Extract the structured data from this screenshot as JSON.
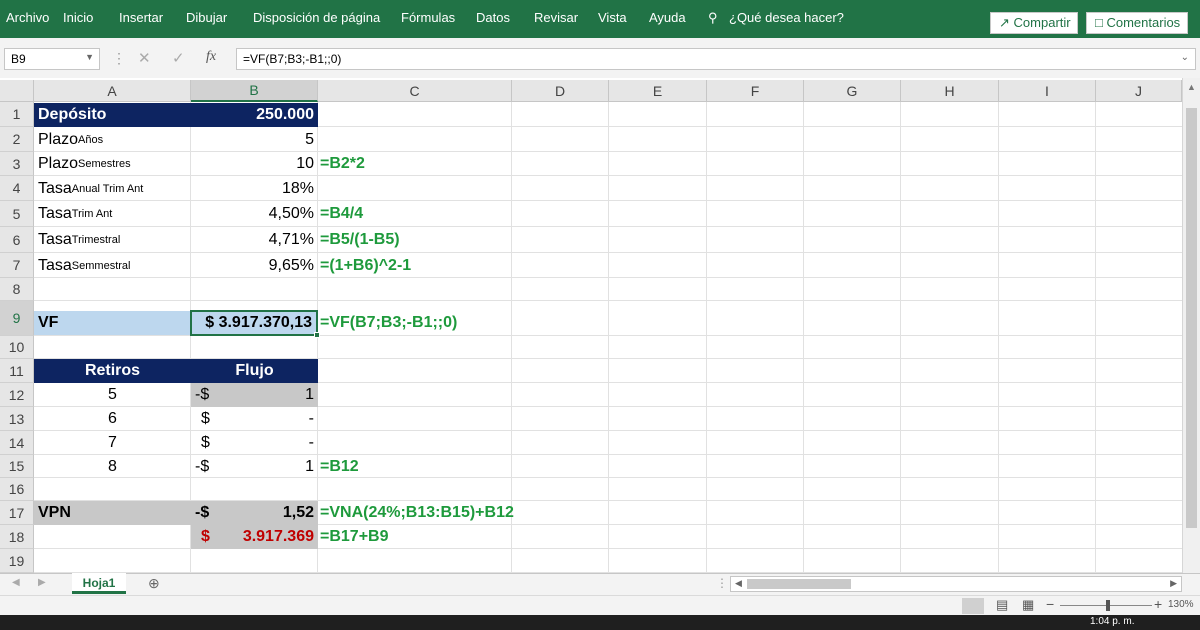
{
  "ribbon": {
    "menu": [
      "Archivo",
      "Inicio",
      "Insertar",
      "Dibujar",
      "Disposición de página",
      "Fórmulas",
      "Datos",
      "Revisar",
      "Vista",
      "Ayuda"
    ],
    "search_placeholder": "¿Qué desea hacer?",
    "share_label": "Compartir",
    "comments_label": "Comentarios"
  },
  "formula_bar": {
    "name_box": "B9",
    "formula": "=VF(B7;B3;-B1;;0)",
    "fx": "fx"
  },
  "columns": [
    "A",
    "B",
    "C",
    "D",
    "E",
    "F",
    "G",
    "H",
    "I",
    "J"
  ],
  "rows": [
    "1",
    "2",
    "3",
    "4",
    "5",
    "6",
    "7",
    "8",
    "9",
    "10",
    "11",
    "12",
    "13",
    "14",
    "15",
    "16",
    "17",
    "18",
    "19"
  ],
  "cells": {
    "a1": "Depósito",
    "b1": "250.000",
    "a2": "Plazo",
    "a2_sub": "Años",
    "b2": "5",
    "a3": "Plazo",
    "a3_sub": "Semestres",
    "b3": "10",
    "c3": "=B2*2",
    "a4": "Tasa",
    "a4_sub": "Anual Trim Ant",
    "b4": "18%",
    "a5": "Tasa",
    "a5_sub": "Trim Ant",
    "b5": "4,50%",
    "c5": "=B4/4",
    "a6": "Tasa",
    "a6_sub": "Trimestral",
    "b6": "4,71%",
    "c6": "=B5/(1-B5)",
    "a7": "Tasa",
    "a7_sub": "Semmestral",
    "b7": "9,65%",
    "c7": "=(1+B6)^2-1",
    "a9": "VF",
    "b9": "$ 3.917.370,13",
    "c9": "=VF(B7;B3;-B1;;0)",
    "a11": "Retiros",
    "b11": "Flujo",
    "a12": "5",
    "b12_sym": "-$",
    "b12_val": "1",
    "a13": "6",
    "b13_sym": "$",
    "b13_val": "-",
    "a14": "7",
    "b14_sym": "$",
    "b14_val": "-",
    "a15": "8",
    "b15_sym": "-$",
    "b15_val": "1",
    "c15": "=B12",
    "a17": "VPN",
    "b17_sym": "-$",
    "b17_val": "1,52",
    "c17": "=VNA(24%;B13:B15)+B12",
    "b18_sym": "$",
    "b18_val": "3.917.369",
    "c18": "=B17+B9"
  },
  "sheet_tab": "Hoja1",
  "status": {
    "zoom": "130%"
  },
  "taskbar": {
    "time": "1:04 p. m."
  },
  "colors": {
    "excel_green": "#217346",
    "navy": "#0d2461",
    "formula_green": "#1e9a3c",
    "negative_red": "#c00000"
  }
}
